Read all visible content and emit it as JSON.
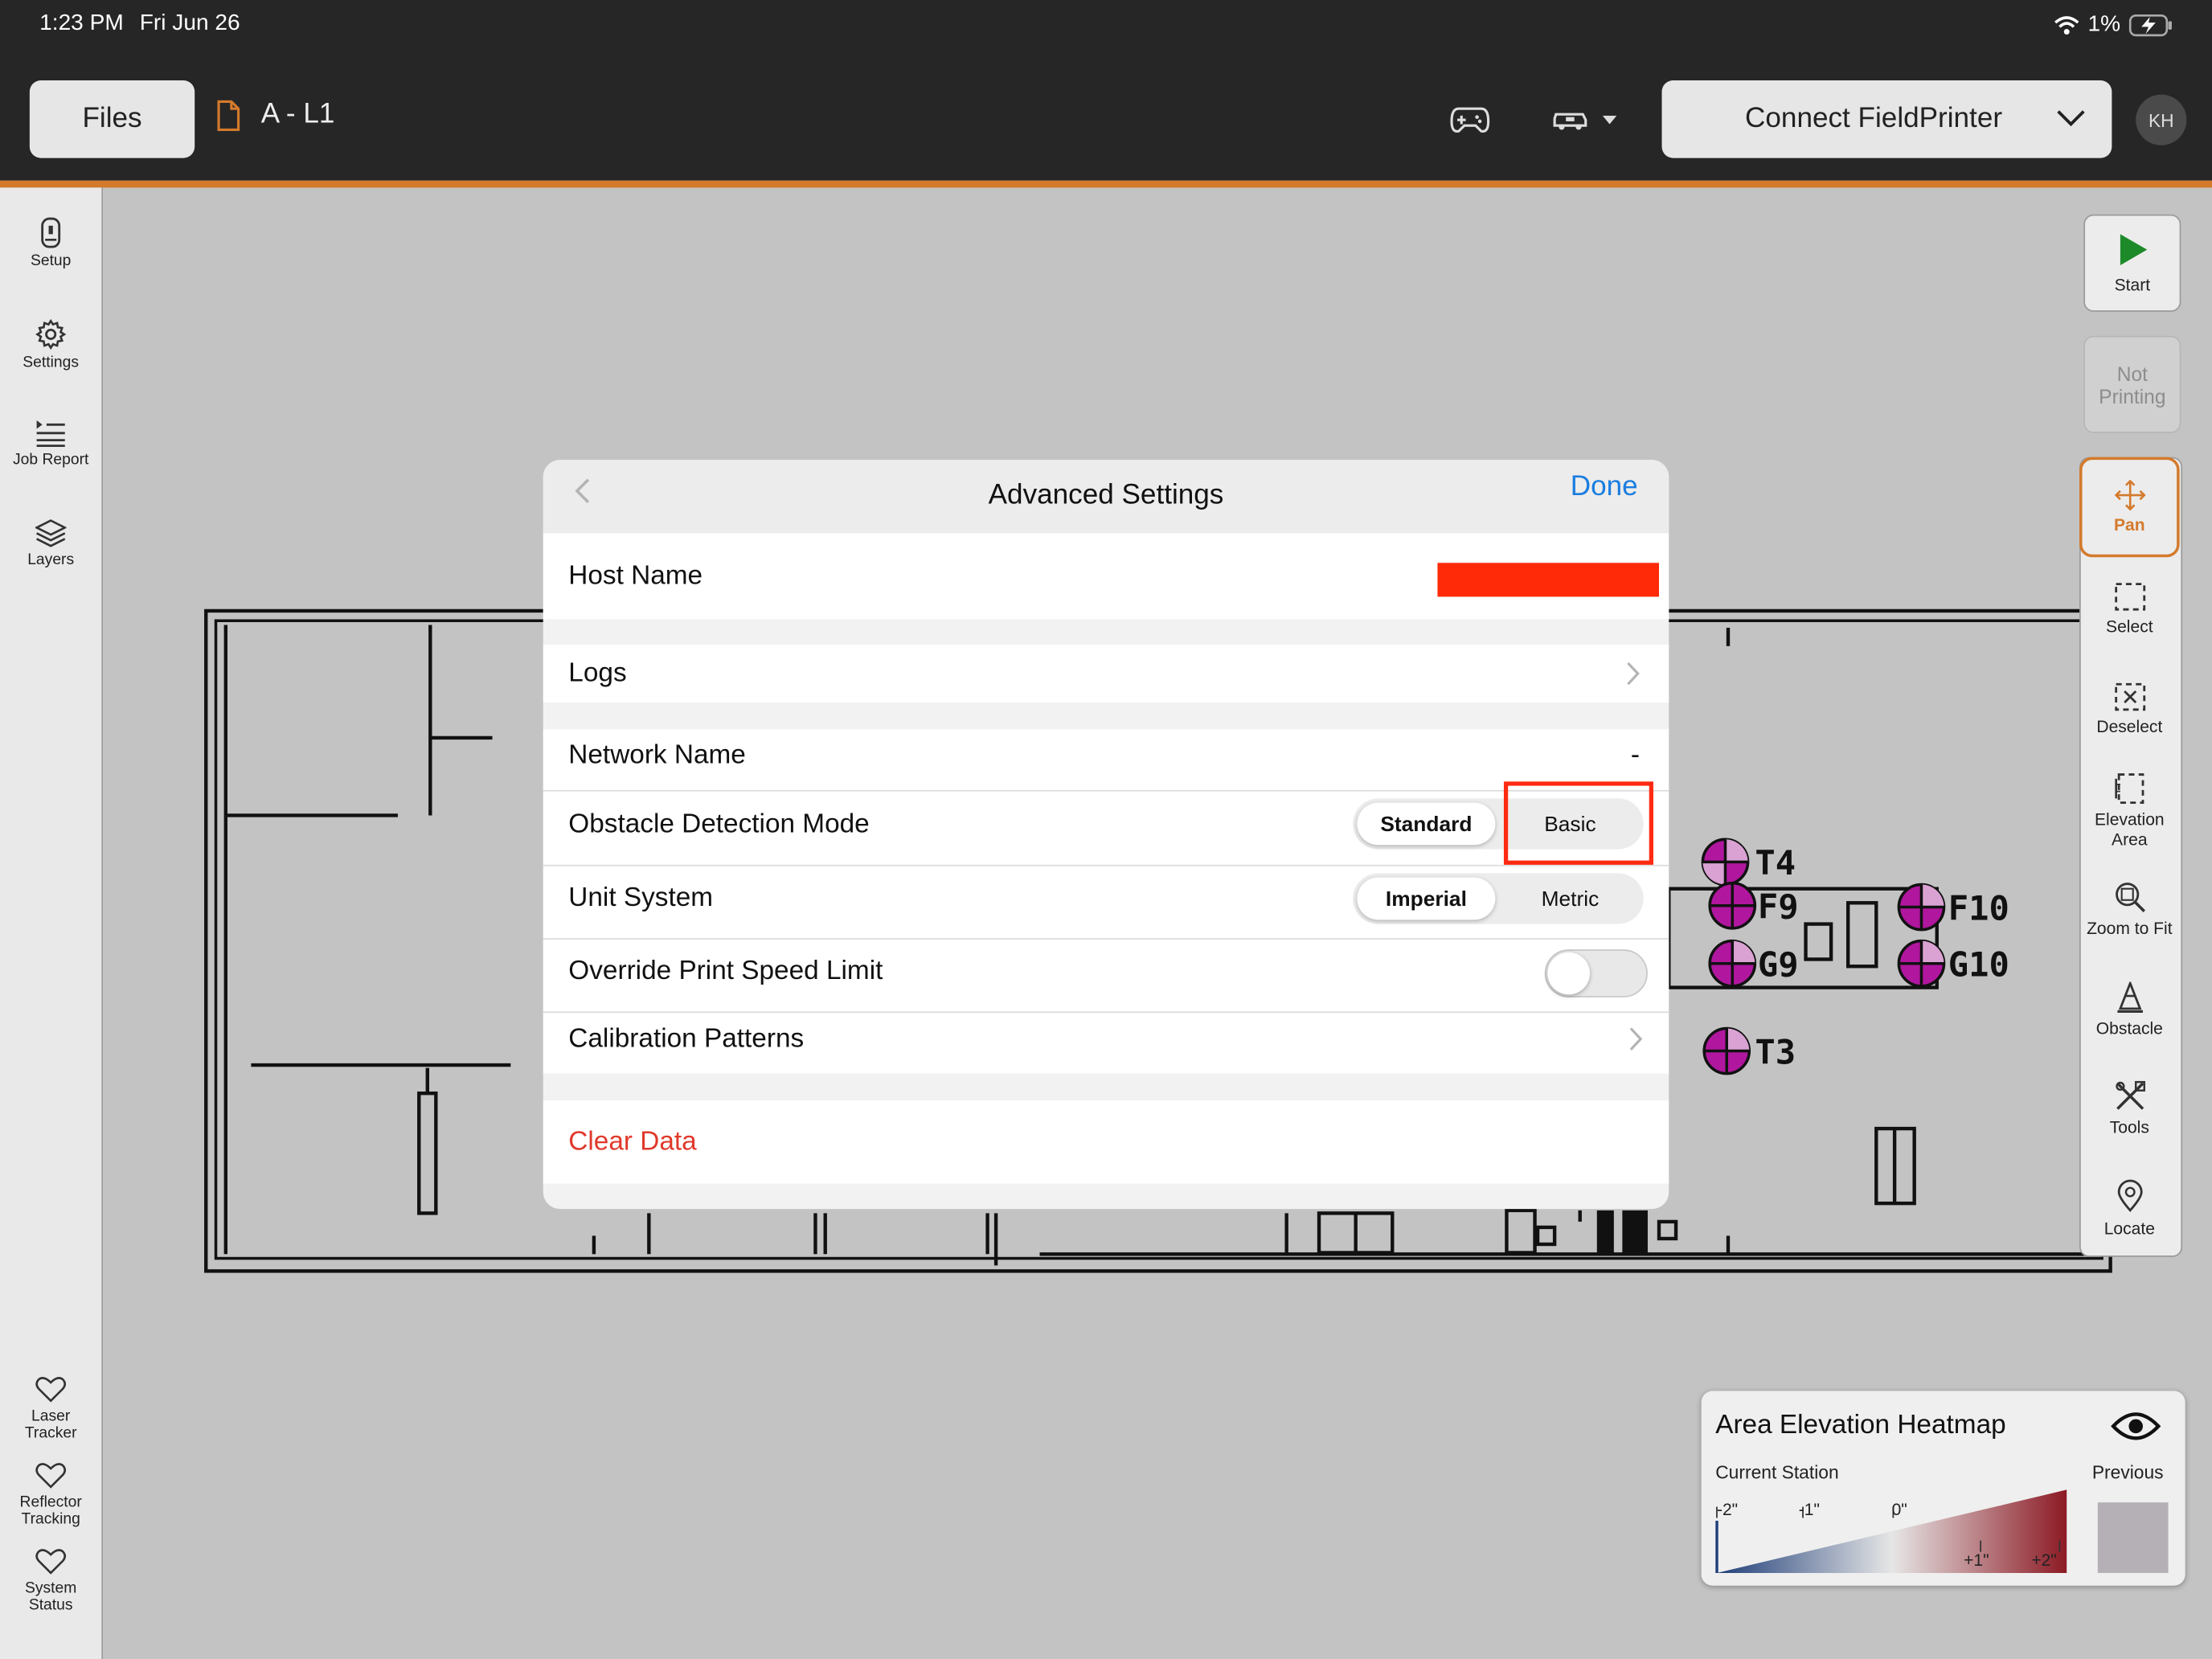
{
  "status_bar": {
    "time": "1:23 PM",
    "date": "Fri Jun 26",
    "battery": "1%"
  },
  "toolbar": {
    "files_label": "Files",
    "doc_title": "A - L1",
    "connect_label": "Connect FieldPrinter",
    "avatar_initials": "KH"
  },
  "left_rail": [
    {
      "label": "Setup",
      "icon": "setup-icon"
    },
    {
      "label": "Settings",
      "icon": "gear-icon"
    },
    {
      "label": "Job Report",
      "icon": "job-report-icon"
    },
    {
      "label": "Layers",
      "icon": "layers-icon"
    }
  ],
  "left_status": [
    {
      "label": "Laser Tracker",
      "icon": "heart-icon"
    },
    {
      "label": "Reflector Tracking",
      "icon": "heart-icon"
    },
    {
      "label": "System Status",
      "icon": "heart-icon"
    }
  ],
  "right_toolbar": {
    "start_label": "Start",
    "not_printing_label": "Not Printing",
    "tools": [
      "Pan",
      "Select",
      "Deselect",
      "Elevation Area",
      "Zoom to Fit",
      "Obstacle",
      "Tools",
      "Locate"
    ]
  },
  "plan_labels": [
    "T4",
    "F9",
    "F10",
    "G9",
    "G10",
    "T3"
  ],
  "modal": {
    "title": "Advanced Settings",
    "done_label": "Done",
    "host_name_label": "Host Name",
    "logs_label": "Logs",
    "network_name_label": "Network Name",
    "network_name_value": "-",
    "obstacle_label": "Obstacle Detection Mode",
    "obstacle_options": [
      "Standard",
      "Basic"
    ],
    "obstacle_selected": "Standard",
    "unit_label": "Unit System",
    "unit_options": [
      "Imperial",
      "Metric"
    ],
    "unit_selected": "Imperial",
    "override_label": "Override Print Speed Limit",
    "override_on": false,
    "calibration_label": "Calibration Patterns",
    "clear_data_label": "Clear Data"
  },
  "heatmap": {
    "title": "Area Elevation Heatmap",
    "current_label": "Current Station",
    "previous_label": "Previous",
    "ticks_top": [
      "-2\"",
      "-1\"",
      "0\""
    ],
    "ticks_bottom": [
      "+1\"",
      "+2\""
    ]
  },
  "colors": {
    "accent": "#d47a2c",
    "link": "#1a7de0",
    "danger": "#e0392b",
    "highlight": "#ff2a12",
    "marker": "#b0179e"
  }
}
